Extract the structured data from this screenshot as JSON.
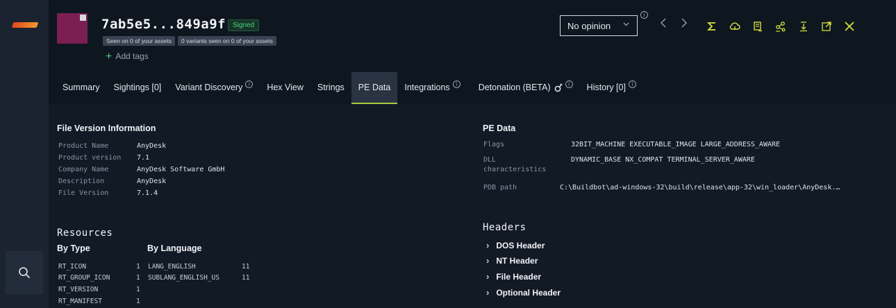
{
  "sample": {
    "hash": "7ab5e5...849a9f",
    "signed_badge": "Signed",
    "seen_chip": "Seen on 0 of your assets",
    "variants_chip": "0 variants seen on 0 of your assets",
    "add_tags": "Add tags",
    "thumb_color": "#7b1e52"
  },
  "toolbar": {
    "opinion_value": "No opinion",
    "prev_icon": "chevron-left-icon",
    "next_icon": "chevron-right-icon",
    "tools": [
      "sigma-icon",
      "cloud-icon",
      "report-icon",
      "graph-icon",
      "download-icon",
      "open-external-icon",
      "close-icon"
    ],
    "accent": "#d6e23a"
  },
  "tabs": [
    {
      "label": "Summary",
      "info": false
    },
    {
      "label": "Sightings [0]",
      "info": false
    },
    {
      "label": "Variant Discovery",
      "info": true
    },
    {
      "label": "Hex View",
      "info": false
    },
    {
      "label": "Strings",
      "info": false
    },
    {
      "label": "PE Data",
      "info": false,
      "active": true
    },
    {
      "label": "Integrations",
      "info": true
    },
    {
      "label": "Detonation (BETA)",
      "info": true,
      "icon": "flask-icon"
    },
    {
      "label": "History [0]",
      "info": true
    }
  ],
  "file_version": {
    "title": "File Version Information",
    "rows": [
      {
        "key": "Product Name",
        "value": "AnyDesk"
      },
      {
        "key": "Product version",
        "value": "7.1"
      },
      {
        "key": "Company Name",
        "value": "AnyDesk Software GmbH"
      },
      {
        "key": "Description",
        "value": "AnyDesk"
      },
      {
        "key": "File Version",
        "value": "7.1.4"
      }
    ]
  },
  "pe_data": {
    "title": "PE Data",
    "rows": [
      {
        "key": "Flags",
        "value": "32BIT_MACHINE EXECUTABLE_IMAGE LARGE_ADDRESS_AWARE"
      },
      {
        "key_line1": "DLL",
        "key_line2": "characteristics",
        "value": "DYNAMIC_BASE NX_COMPAT TERMINAL_SERVER_AWARE"
      },
      {
        "key": "PDB path",
        "value": "C:\\Buildbot\\ad-windows-32\\build\\release\\app-32\\win_loader\\AnyDesk.…"
      }
    ]
  },
  "resources": {
    "title": "Resources",
    "by_type_label": "By Type",
    "by_language_label": "By Language",
    "by_type": [
      {
        "name": "RT_ICON",
        "count": "1"
      },
      {
        "name": "RT_GROUP_ICON",
        "count": "1"
      },
      {
        "name": "RT_VERSION",
        "count": "1"
      },
      {
        "name": "RT_MANIFEST",
        "count": "1"
      }
    ],
    "by_language": [
      {
        "name": "LANG_ENGLISH",
        "count": "11"
      },
      {
        "name": "SUBLANG_ENGLISH_US",
        "count": "11"
      }
    ]
  },
  "headers": {
    "title": "Headers",
    "items": [
      "DOS Header",
      "NT Header",
      "File Header",
      "Optional Header"
    ]
  }
}
